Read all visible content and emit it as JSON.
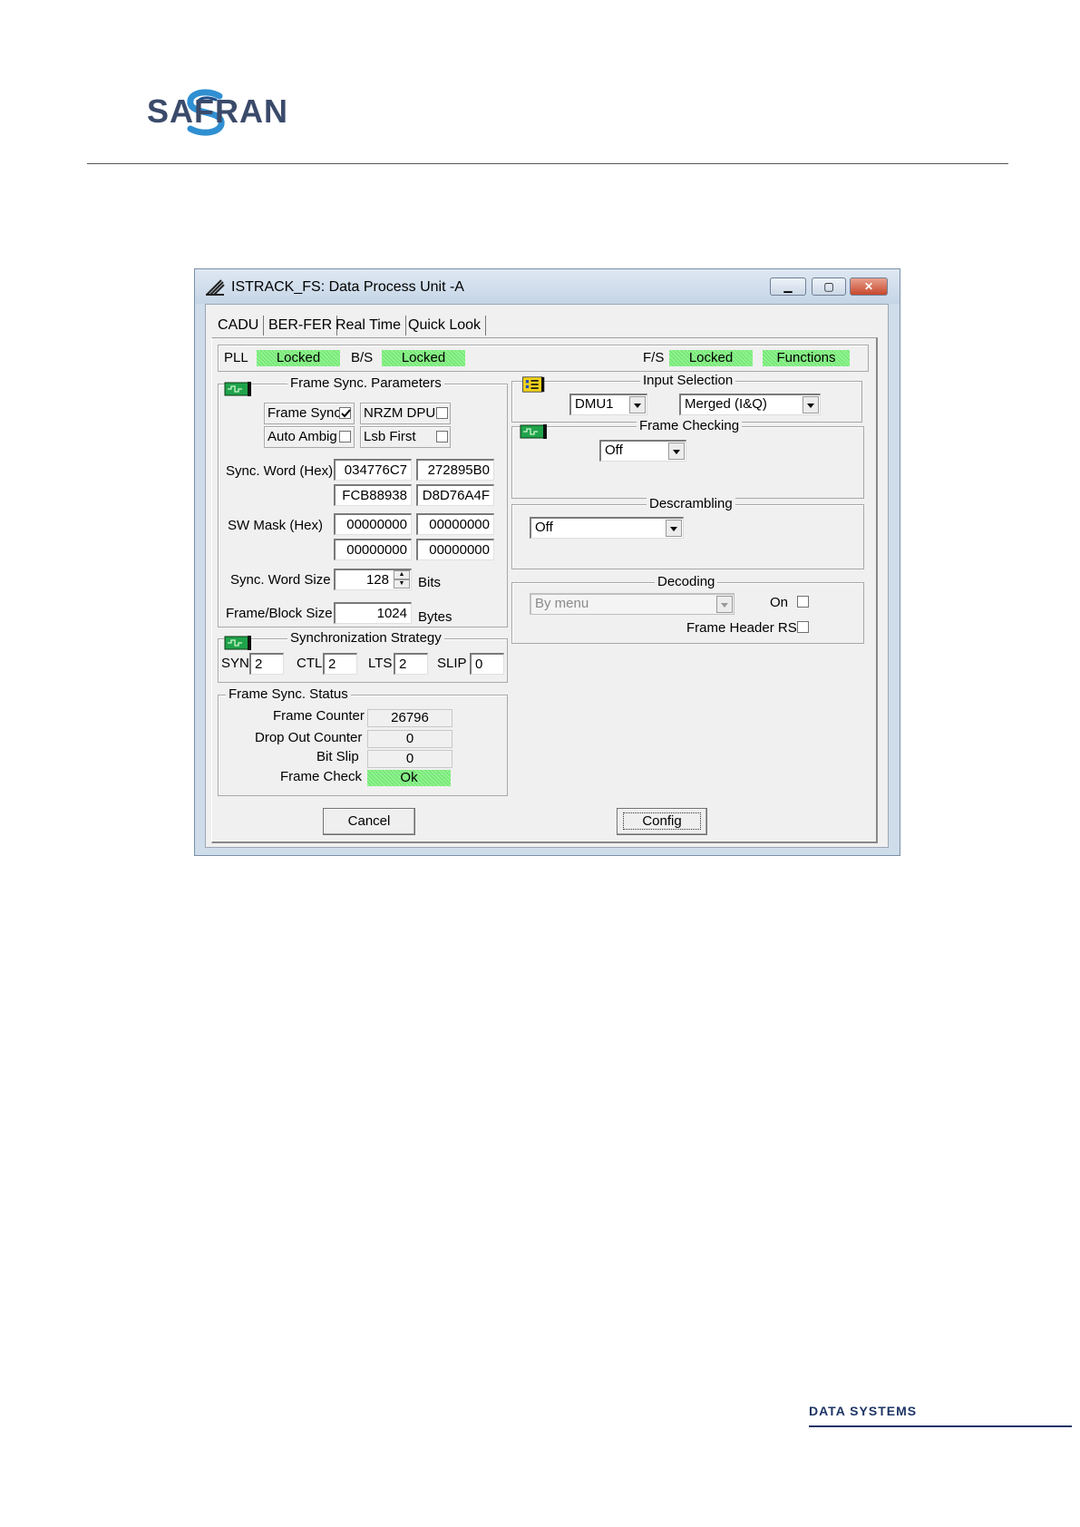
{
  "brand": {
    "logo_text": "SAFRAN",
    "footer_text": "DATA SYSTEMS"
  },
  "window": {
    "title": "ISTRACK_FS: Data Process Unit -A",
    "tabs": [
      "CADU",
      "BER-FER",
      "Real Time",
      "Quick Look"
    ],
    "status": {
      "pll_label": "PLL",
      "pll_value": "Locked",
      "bs_label": "B/S",
      "bs_value": "Locked",
      "fs_label": "F/S",
      "fs_value": "Locked",
      "functions": "Functions"
    },
    "frame_sync_params": {
      "title": "Frame Sync. Parameters",
      "frame_sync_label": "Frame Sync",
      "nrzm_label": "NRZM DPU",
      "auto_ambig_label": "Auto Ambig",
      "lsb_first_label": "Lsb First",
      "sync_word_label": "Sync. Word (Hex)",
      "sync_word": [
        "034776C7",
        "272895B0",
        "FCB88938",
        "D8D76A4F"
      ],
      "sw_mask_label": "SW  Mask (Hex)",
      "sw_mask": [
        "00000000",
        "00000000",
        "00000000",
        "00000000"
      ],
      "sync_word_size_label": "Sync. Word Size",
      "sync_word_size": "128",
      "bits_unit": "Bits",
      "frame_block_size_label": "Frame/Block Size",
      "frame_block_size": "1024",
      "bytes_unit": "Bytes"
    },
    "sync_strategy": {
      "title": "Synchronization Strategy",
      "syn_label": "SYN",
      "syn": "2",
      "ctl_label": "CTL",
      "ctl": "2",
      "lts_label": "LTS",
      "lts": "2",
      "slip_label": "SLIP",
      "slip": "0"
    },
    "frame_sync_status": {
      "title": "Frame Sync. Status",
      "frame_counter_label": "Frame Counter",
      "frame_counter": "26796",
      "drop_out_label": "Drop Out Counter",
      "drop_out": "0",
      "bit_slip_label": "Bit Slip",
      "bit_slip": "0",
      "frame_check_label": "Frame Check",
      "frame_check": "Ok"
    },
    "input_selection": {
      "title": "Input Selection",
      "source": "DMU1",
      "mode": "Merged (I&Q)"
    },
    "frame_checking": {
      "title": "Frame Checking",
      "value": "Off"
    },
    "descrambling": {
      "title": "Descrambling",
      "value": "Off"
    },
    "decoding": {
      "title": "Decoding",
      "value": "By menu",
      "on_label": "On",
      "frame_header_rs_label": "Frame Header RS"
    },
    "buttons": {
      "cancel": "Cancel",
      "config": "Config"
    },
    "colors": {
      "lamp_green": "#8df58d",
      "chip_green": "#1fa34a",
      "chip_yellow": "#f2d21b"
    }
  }
}
